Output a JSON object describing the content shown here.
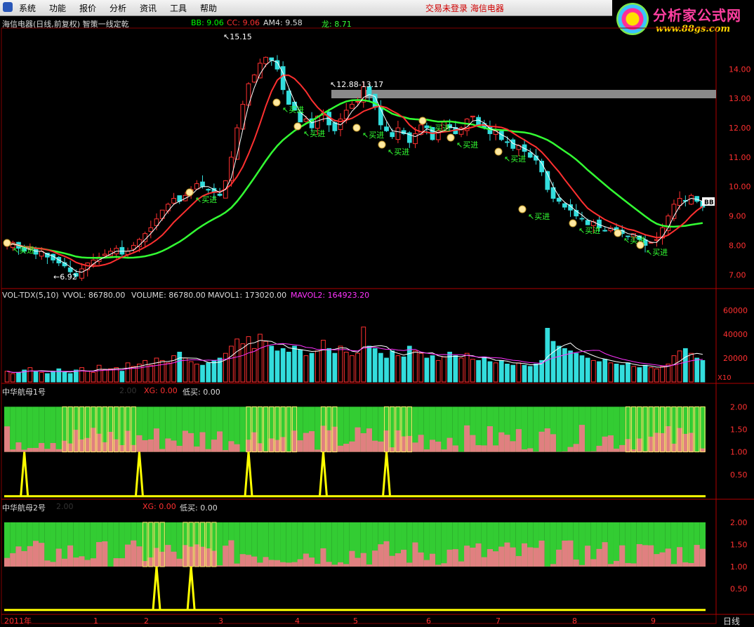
{
  "menu": {
    "items": [
      "系统",
      "功能",
      "报价",
      "分析",
      "资讯",
      "工具",
      "帮助"
    ],
    "status": "交易未登录  海信电器"
  },
  "logo": {
    "title": "分析家公式网",
    "url": "www.88gs.com"
  },
  "main_panel": {
    "title": "海信电器(日线,前复权) 智策一线定乾",
    "indicators": [
      {
        "label": "BB: 9.06",
        "color": "#ffffff"
      },
      {
        "label": "CC: 9.06",
        "color": "#ff3030"
      },
      {
        "label": "AM4: 9.58",
        "color": "#ffffff"
      },
      {
        "label": "龙: 8.71",
        "color": "#33ff33"
      }
    ],
    "annotations": {
      "high": "15.15",
      "low": "6.92",
      "range": "12.88-13.17",
      "buy": "买进"
    },
    "y_ticks": [
      "14.00",
      "13.00",
      "12.00",
      "11.00",
      "10.00",
      "9.00",
      "8.00",
      "7.00"
    ],
    "price_tag": "BB"
  },
  "vol_panel": {
    "header": [
      {
        "label": "VOL-TDX(5,10)",
        "color": "#ffffff"
      },
      {
        "label": "VVOL: 86780.00",
        "color": "#ffffff"
      },
      {
        "label": "VOLUME: 86780.00",
        "color": "#ffffff"
      },
      {
        "label": "MAVOL1: 173020.00",
        "color": "#ffffff"
      },
      {
        "label": "MAVOL2: 164923.20",
        "color": "#ff33ff"
      }
    ],
    "y_ticks": [
      "60000",
      "40000",
      "20000"
    ],
    "unit": "X10"
  },
  "panel1": {
    "title": "中华航母1号",
    "value": "2.00",
    "xg": "XG: 0.00",
    "dimai": "低买: 0.00",
    "y_ticks": [
      "2.00",
      "1.50",
      "1.00",
      "0.50"
    ]
  },
  "panel2": {
    "title": "中华航母2号",
    "value": "2.00",
    "xg": "XG: 0.00",
    "dimai": "低买: 0.00",
    "y_ticks": [
      "2.00",
      "1.50",
      "1.00",
      "0.50"
    ]
  },
  "x_axis": {
    "labels": [
      "2011年",
      "1",
      "2",
      "3",
      "4",
      "5",
      "6",
      "7",
      "8",
      "9",
      "2011年"
    ],
    "period": "日线"
  },
  "chart_data": {
    "type": "candlestick",
    "x_label": "",
    "y_range": [
      6.6,
      15.3
    ],
    "close": [
      8.0,
      8.1,
      7.9,
      7.8,
      7.9,
      7.7,
      7.8,
      7.6,
      7.5,
      7.4,
      7.3,
      7.1,
      6.95,
      7.2,
      7.4,
      7.5,
      7.6,
      7.7,
      7.8,
      7.9,
      7.7,
      7.8,
      8.0,
      8.2,
      8.4,
      8.6,
      8.9,
      9.2,
      9.4,
      9.6,
      9.5,
      9.7,
      9.9,
      10.1,
      10.0,
      9.9,
      9.8,
      9.7,
      10.2,
      11.0,
      12.0,
      12.8,
      13.5,
      13.8,
      14.2,
      14.4,
      14.3,
      14.0,
      13.3,
      12.8,
      12.6,
      12.2,
      12.3,
      12.0,
      12.4,
      12.5,
      12.1,
      11.9,
      12.3,
      12.6,
      12.8,
      12.9,
      13.4,
      13.1,
      12.7,
      12.1,
      11.9,
      11.7,
      12.0,
      11.8,
      11.5,
      11.8,
      12.1,
      12.0,
      11.6,
      11.9,
      12.2,
      12.0,
      11.8,
      12.0,
      12.3,
      12.4,
      12.1,
      12.0,
      11.8,
      11.9,
      11.6,
      11.5,
      11.3,
      11.4,
      11.2,
      11.0,
      10.9,
      10.5,
      9.9,
      9.6,
      9.5,
      9.3,
      9.2,
      9.0,
      8.9,
      8.7,
      8.8,
      8.6,
      8.5,
      8.6,
      8.5,
      8.4,
      8.3,
      8.4,
      8.2,
      8.0,
      8.1,
      8.2,
      8.6,
      9.0,
      9.4,
      9.6,
      9.5,
      9.7,
      9.5,
      9.3
    ],
    "series": [
      {
        "name": "BB",
        "color": "#ffffff"
      },
      {
        "name": "CC",
        "color": "#ff3030"
      },
      {
        "name": "龙",
        "color": "#33ff33"
      }
    ],
    "volume": [
      9,
      7,
      8,
      10,
      12,
      9,
      8,
      7,
      9,
      11,
      8,
      7,
      10,
      12,
      9,
      8,
      14,
      10,
      11,
      12,
      9,
      16,
      13,
      15,
      18,
      14,
      20,
      18,
      16,
      22,
      25,
      20,
      17,
      15,
      14,
      16,
      18,
      20,
      24,
      30,
      36,
      32,
      38,
      28,
      40,
      34,
      30,
      26,
      28,
      25,
      30,
      27,
      22,
      24,
      26,
      35,
      28,
      24,
      30,
      25,
      22,
      24,
      46,
      30,
      28,
      24,
      20,
      26,
      22,
      21,
      30,
      26,
      24,
      20,
      22,
      18,
      21,
      25,
      22,
      20,
      24,
      19,
      18,
      21,
      17,
      16,
      18,
      15,
      14,
      16,
      14,
      13,
      15,
      18,
      45,
      34,
      30,
      28,
      26,
      24,
      22,
      20,
      18,
      17,
      19,
      16,
      15,
      14,
      16,
      13,
      12,
      14,
      12,
      11,
      13,
      15,
      22,
      26,
      28,
      24,
      20,
      18
    ],
    "xg1": [
      0,
      0,
      0,
      1,
      0,
      0,
      0,
      0,
      0,
      0,
      0,
      0,
      0,
      0,
      0,
      0,
      0,
      0,
      0,
      0,
      0,
      0,
      1,
      0,
      0,
      0,
      0,
      0,
      0,
      0,
      0,
      0,
      0,
      0,
      0,
      0,
      0,
      0,
      0,
      0,
      0,
      0,
      0,
      0,
      0,
      0,
      0,
      0,
      0,
      0,
      0,
      0,
      0,
      0,
      0,
      0,
      0,
      0,
      0,
      0,
      0,
      0,
      0,
      0,
      0,
      0,
      0,
      0,
      0,
      0,
      0,
      0,
      0,
      0,
      0,
      0,
      0,
      0,
      0,
      0,
      0,
      0,
      0,
      0,
      0,
      0,
      0,
      0,
      0,
      0,
      0,
      0,
      0,
      0,
      0,
      0,
      0,
      0,
      0,
      0,
      0,
      0,
      0,
      0,
      0,
      0,
      0,
      0,
      0,
      0,
      0,
      0,
      0,
      0,
      0,
      0,
      0,
      0,
      0,
      0,
      0,
      0
    ],
    "dimai1_spikes": [
      3,
      23,
      42,
      55,
      66
    ],
    "dimai2_spikes": [
      26,
      32
    ]
  }
}
